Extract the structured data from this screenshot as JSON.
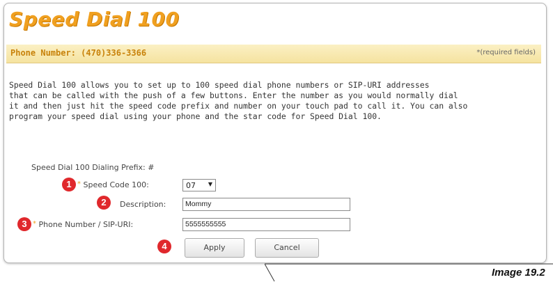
{
  "title": "Speed Dial 100",
  "phone_number_label": "Phone Number: (470)336-3366",
  "required_note": "*(required fields)",
  "intro_text": "Speed Dial 100 allows you to set up to 100 speed dial phone numbers or SIP-URI addresses\nthat can be called with the push of a few buttons. Enter the number as you would normally dial\nit and then just hit the speed code prefix and number on your touch pad to call it. You can also\nprogram your speed dial using your phone and the star code for Speed Dial 100.",
  "form": {
    "prefix_label": "Speed Dial 100 Dialing Prefix: #",
    "speed_code_label": "Speed Code 100:",
    "speed_code_value": "07",
    "description_label": "Description:",
    "description_value": "Mommy",
    "phone_label": "Phone Number / SIP-URI:",
    "phone_value": "5555555555",
    "apply_label": "Apply",
    "cancel_label": "Cancel"
  },
  "badges": [
    "1",
    "2",
    "3",
    "4"
  ],
  "caption": "Image 19.2",
  "colors": {
    "accent": "#f0a020",
    "badge": "#e0282c"
  }
}
